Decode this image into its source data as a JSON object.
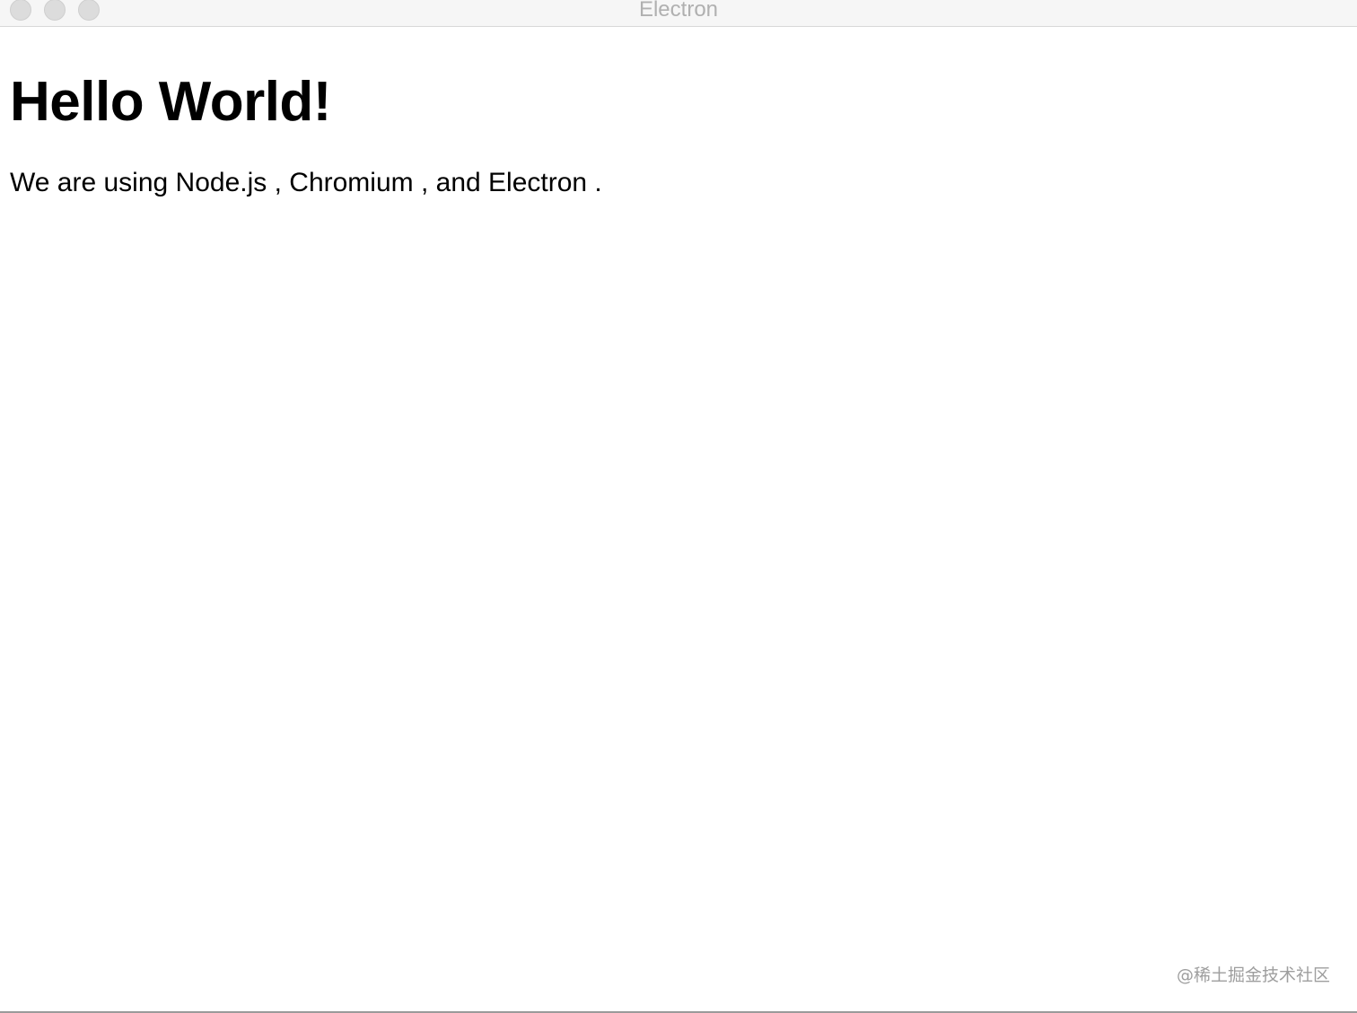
{
  "window": {
    "title": "Electron"
  },
  "page": {
    "heading": "Hello World!",
    "paragraph": {
      "prefix": "We are using Node.js ",
      "mid1": ", Chromium ",
      "mid2": ", and Electron ",
      "suffix": "."
    }
  },
  "watermark": "@稀土掘金技术社区",
  "colors": {
    "titlebar_bg": "#f6f6f6",
    "title_text": "#b0b0b0",
    "traffic_light": "#dcdcdc",
    "body_text": "#000000",
    "watermark": "#9e9e9e"
  }
}
